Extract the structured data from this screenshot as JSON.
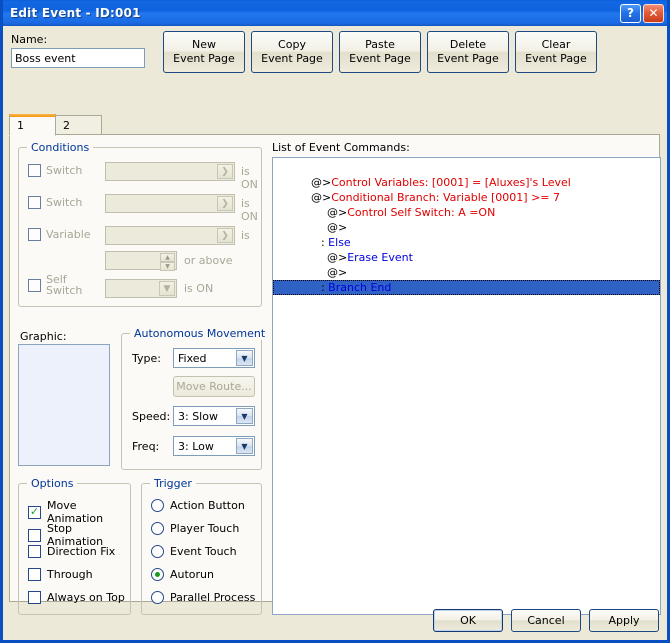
{
  "window": {
    "title": "Edit Event - ID:001",
    "help_button": "?",
    "close_button": "✕"
  },
  "name_field": {
    "label": "Name:",
    "value": "Boss event",
    "placeholder": ""
  },
  "toolbar": {
    "buttons": [
      {
        "line1": "New",
        "line2": "Event Page"
      },
      {
        "line1": "Copy",
        "line2": "Event Page"
      },
      {
        "line1": "Paste",
        "line2": "Event Page"
      },
      {
        "line1": "Delete",
        "line2": "Event Page"
      },
      {
        "line1": "Clear",
        "line2": "Event Page"
      }
    ]
  },
  "tabs": {
    "items": [
      {
        "label": "1",
        "active": true
      },
      {
        "label": "2",
        "active": false
      }
    ]
  },
  "conditions": {
    "legend": "Conditions",
    "rows": [
      {
        "label": "Switch",
        "value": "",
        "suffix": "is ON"
      },
      {
        "label": "Switch",
        "value": "",
        "suffix": "is ON"
      },
      {
        "label": "Variable",
        "value": "",
        "suffix": "is"
      },
      {
        "label": "",
        "value": "",
        "suffix": "or above"
      },
      {
        "label": "Self Switch",
        "value": "",
        "suffix": "is ON"
      }
    ]
  },
  "graphic": {
    "label": "Graphic:",
    "value": ""
  },
  "autonomous_movement": {
    "legend": "Autonomous Movement",
    "type_label": "Type:",
    "type_value": "Fixed",
    "move_route_button": "Move Route...",
    "speed_label": "Speed:",
    "speed_value": "3: Slow",
    "freq_label": "Freq:",
    "freq_value": "3: Low"
  },
  "options": {
    "legend": "Options",
    "items": [
      {
        "label": "Move Animation",
        "checked": true
      },
      {
        "label": "Stop Animation",
        "checked": false
      },
      {
        "label": "Direction Fix",
        "checked": false
      },
      {
        "label": "Through",
        "checked": false
      },
      {
        "label": "Always on Top",
        "checked": false
      }
    ]
  },
  "trigger": {
    "legend": "Trigger",
    "items": [
      {
        "label": "Action Button",
        "selected": false
      },
      {
        "label": "Player Touch",
        "selected": false
      },
      {
        "label": "Event Touch",
        "selected": false
      },
      {
        "label": "Autorun",
        "selected": true
      },
      {
        "label": "Parallel Process",
        "selected": false
      }
    ]
  },
  "command_list": {
    "label": "List of Event Commands:",
    "lines": [
      {
        "indent": 0,
        "prefix": "@>",
        "text": "Control Variables: [0001] = [Aluxes]'s Level",
        "color": "red",
        "selected": false
      },
      {
        "indent": 0,
        "prefix": "@>",
        "text": "Conditional Branch: Variable [0001] >= 7",
        "color": "red",
        "selected": false
      },
      {
        "indent": 1,
        "prefix": "@>",
        "text": "Control Self Switch: A =ON",
        "color": "red",
        "selected": false
      },
      {
        "indent": 1,
        "prefix": "@>",
        "text": "",
        "color": "red",
        "selected": false
      },
      {
        "indent": 1,
        "prefix": ":",
        "text": " Else",
        "color": "blue",
        "selected": false
      },
      {
        "indent": 1,
        "prefix": "@>",
        "text": "Erase Event",
        "color": "blue",
        "selected": false
      },
      {
        "indent": 1,
        "prefix": "@>",
        "text": "",
        "color": "blue",
        "selected": false
      },
      {
        "indent": 1,
        "prefix": ":",
        "text": " Branch End",
        "color": "blue",
        "selected": false
      },
      {
        "indent": 0,
        "prefix": "@>",
        "text": "",
        "color": "blue",
        "selected": true
      }
    ]
  },
  "footer": {
    "ok": "OK",
    "cancel": "Cancel",
    "apply": "Apply"
  },
  "colors": {
    "title_bar": "#1467e2",
    "selection": "#2f62c4",
    "command_red": "#e00000",
    "command_blue": "#0000e0",
    "legend_text": "#00359a",
    "check_green": "#1f9c28",
    "tab_accent": "#ee9715"
  }
}
